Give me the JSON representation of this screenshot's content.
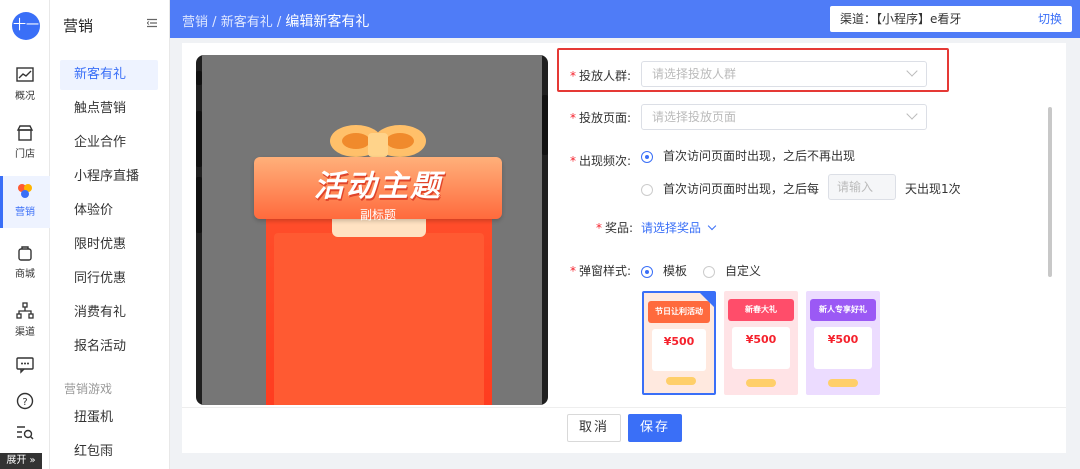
{
  "rail": {
    "logo": "十一",
    "items": [
      {
        "label": "概况",
        "icon": "chart-icon"
      },
      {
        "label": "门店",
        "icon": "store-icon"
      },
      {
        "label": "营销",
        "icon": "marketing-icon"
      },
      {
        "label": "商城",
        "icon": "bag-icon"
      },
      {
        "label": "渠道",
        "icon": "channel-icon"
      }
    ],
    "expand": "展开 »"
  },
  "menu": {
    "title": "营销",
    "items": [
      "新客有礼",
      "触点营销",
      "企业合作",
      "小程序直播",
      "体验价",
      "限时优惠",
      "同行优惠",
      "消费有礼",
      "报名活动"
    ],
    "group": "营销游戏",
    "game_items": [
      "扭蛋机",
      "红包雨"
    ]
  },
  "header": {
    "crumb1": "营销",
    "crumb2": "新客有礼",
    "crumb_sep": "/",
    "current": "编辑新客有礼",
    "channel_label": "渠道：【小程序】e看牙",
    "switch": "切换"
  },
  "preview": {
    "title": "活动主题",
    "subtitle": "副标题"
  },
  "form": {
    "audience_label": "投放人群:",
    "audience_placeholder": "请选择投放人群",
    "page_label": "投放页面:",
    "page_placeholder": "请选择投放页面",
    "freq_label": "出现频次:",
    "freq_opt1": "首次访问页面时出现，之后不再出现",
    "freq_opt2_pre": "首次访问页面时出现，之后每",
    "freq_input_placeholder": "请输入",
    "freq_opt2_post": "天出现1次",
    "prize_label": "奖品:",
    "prize_link": "请选择奖品",
    "style_label": "弹窗样式:",
    "style_opt1": "模板",
    "style_opt2": "自定义"
  },
  "templates": [
    {
      "head": "节日让利活动",
      "amount": "¥500",
      "color": "#ff6a3d"
    },
    {
      "head": "新春大礼",
      "amount": "¥500",
      "color": "#ff4d6a"
    },
    {
      "head": "新人专享好礼",
      "amount": "¥500",
      "color": "#9b59f5"
    }
  ],
  "footer": {
    "cancel": "取消",
    "save": "保存"
  }
}
